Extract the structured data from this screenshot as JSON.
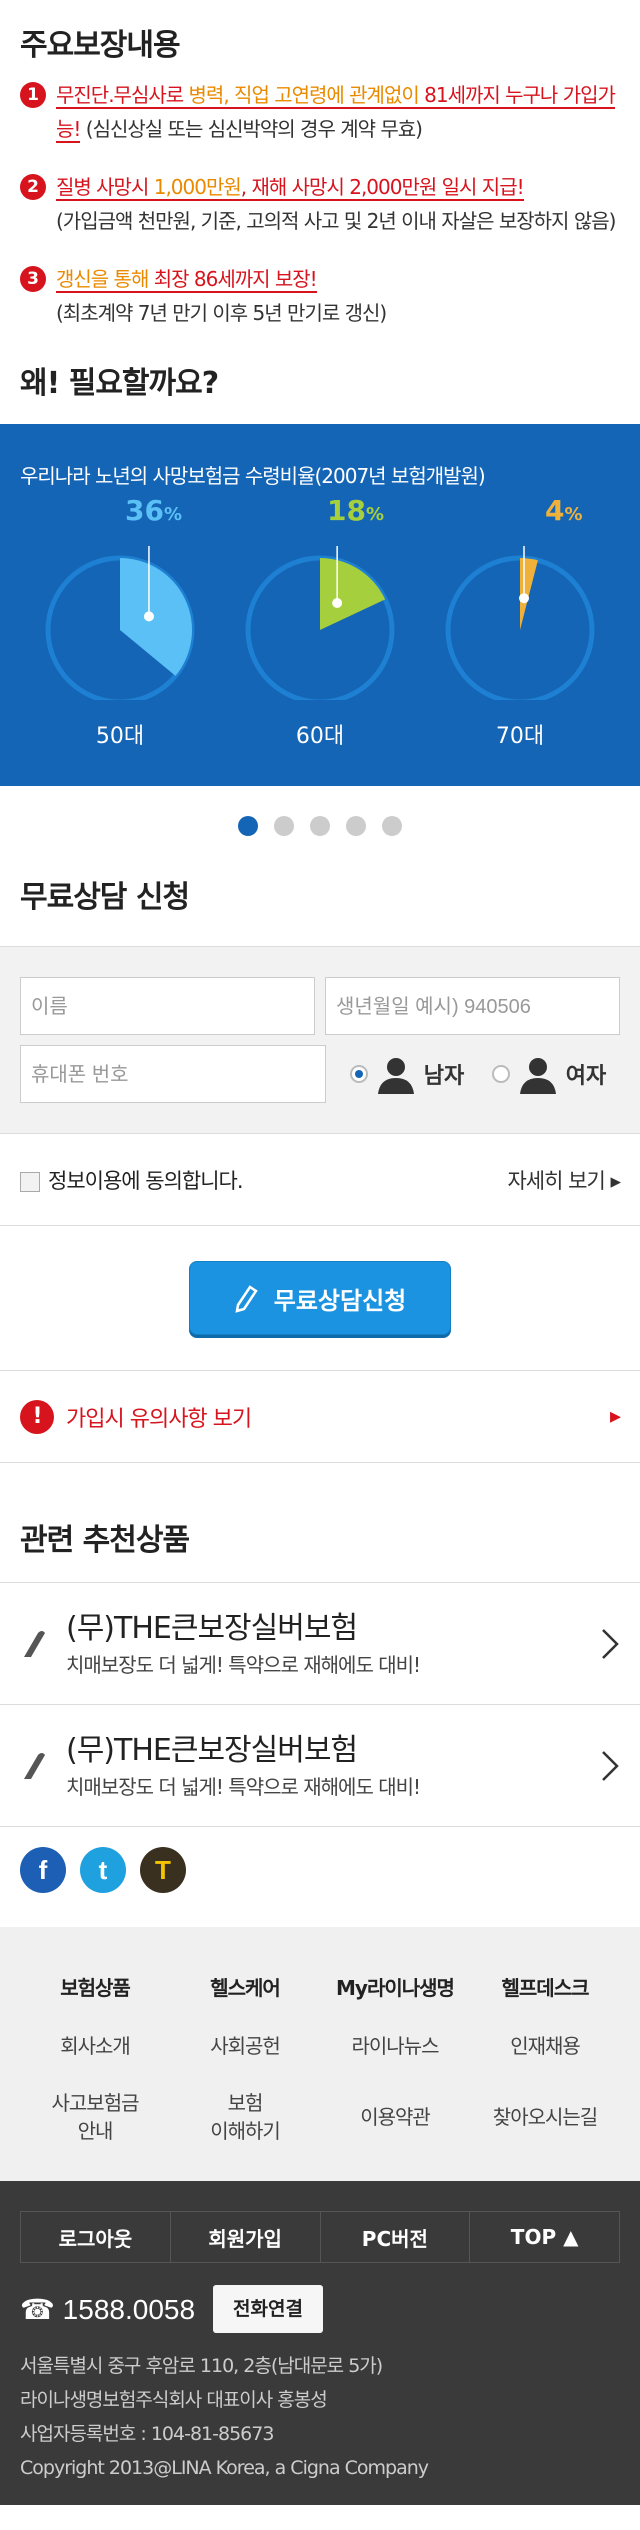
{
  "coverage": {
    "title": "주요보장내용",
    "points": [
      {
        "num": "1",
        "a": "무진단.무심사로",
        "b": " 병력, 직업 고연령에 관계없이 ",
        "c": "81세까지 누구나 가입가능!",
        "d": " (심신상실 또는 심신박약의 경우 계약 무효)"
      },
      {
        "num": "2",
        "a": "질병 사망시 ",
        "b": "1,000만원",
        "c": ", 재해 사망시 ",
        "d": "2,000만원 일시 지급!",
        "e": "(가입금액 천만원, 기준, 고의적 사고 및 2년 이내 자살은 보장하지 않음)"
      },
      {
        "num": "3",
        "a": "갱신을 통해 ",
        "b": "최장 86세까지 보장!",
        "e": "(최초계약 7년 만기 이후 5년 만기로 갱신)"
      }
    ]
  },
  "why": {
    "title": "왜! 필요할까요?"
  },
  "slide": {
    "caption": "우리나라 노년의 사망보험금 수령비율(2007년 보험개발원)",
    "pies": [
      {
        "pct": "36",
        "unit": "%",
        "label": "50대",
        "color": "#5bc0f5"
      },
      {
        "pct": "18",
        "unit": "%",
        "label": "60대",
        "color": "#a5cf3c"
      },
      {
        "pct": "4",
        "unit": "%",
        "label": "70대",
        "color": "#f0b13a"
      }
    ],
    "dots": 5,
    "active": 0
  },
  "consult": {
    "title": "무료상담 신청",
    "name_ph": "이름",
    "birth_ph": "생년월일  예시) 940506",
    "phone_ph": "휴대폰 번호",
    "male": "남자",
    "female": "여자",
    "agree": "정보이용에 동의합니다.",
    "more": "자세히 보기",
    "button": "무료상담신청"
  },
  "notice": {
    "label": "가입시 유의사항 보기"
  },
  "recommend": {
    "title": "관련 추천상품",
    "items": [
      {
        "name": "(무)THE큰보장실버보험",
        "desc": "치매보장도 더 넓게! 특약으로 재해에도 대비!"
      },
      {
        "name": "(무)THE큰보장실버보험",
        "desc": "치매보장도 더 넓게! 특약으로 재해에도 대비!"
      }
    ]
  },
  "social": [
    {
      "icon": "facebook-icon",
      "glyph": "f",
      "color": "#1d5fb4"
    },
    {
      "icon": "twitter-icon",
      "glyph": "t",
      "color": "#1fa1e0"
    },
    {
      "icon": "t-icon",
      "glyph": "T",
      "color": "#3a3020"
    }
  ],
  "footer": {
    "menu": [
      {
        "label": "보험상품",
        "hd": true
      },
      {
        "label": "헬스케어",
        "hd": true
      },
      {
        "label": "My라이나생명",
        "hd": true
      },
      {
        "label": "헬프데스크",
        "hd": true
      },
      {
        "label": "회사소개"
      },
      {
        "label": "사회공헌"
      },
      {
        "label": "라이나뉴스"
      },
      {
        "label": "인재채용"
      },
      {
        "label": "사고보험금\n안내",
        "tall": true
      },
      {
        "label": "보험\n이해하기",
        "tall": true
      },
      {
        "label": "이용약관",
        "tall": true
      },
      {
        "label": "찾아오시는길",
        "tall": true
      }
    ],
    "toolbar": [
      "로그아웃",
      "회원가입",
      "PC버전",
      "TOP ▲"
    ],
    "phone": "1588.0058",
    "call": "전화연결",
    "addr": [
      "서울특별시 중구 후암로 110, 2층(남대문로 5가)",
      "라이나생명보험주식회사   대표이사 홍봉성",
      "사업자등록번호 : 104-81-85673",
      "Copyright 2013@LINA Korea, a Cigna Company"
    ]
  }
}
